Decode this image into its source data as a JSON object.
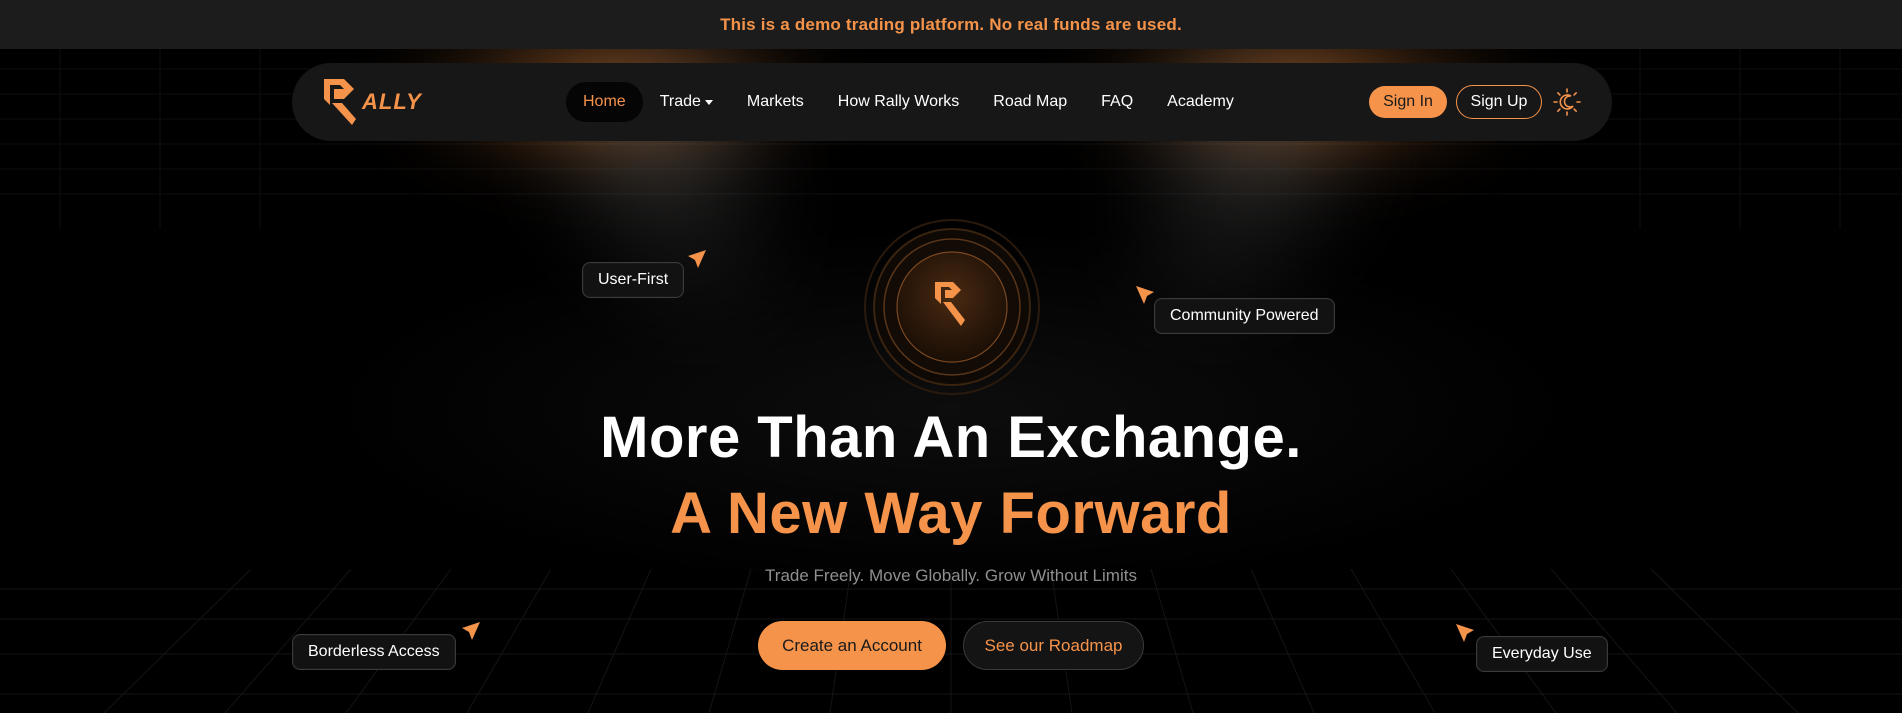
{
  "banner": {
    "text": "This is a demo trading platform. No real funds are used."
  },
  "brand": {
    "name": "ALLY",
    "accent": "#f5934a"
  },
  "nav": {
    "items": [
      {
        "label": "Home",
        "active": true
      },
      {
        "label": "Trade",
        "dropdown": true
      },
      {
        "label": "Markets"
      },
      {
        "label": "How Rally Works"
      },
      {
        "label": "Road Map"
      },
      {
        "label": "FAQ"
      },
      {
        "label": "Academy"
      }
    ],
    "sign_in": "Sign In",
    "sign_up": "Sign Up",
    "theme_icon": "sun-moon-icon"
  },
  "tags": {
    "user_first": "User-First",
    "community": "Community Powered",
    "borderless": "Borderless Access",
    "everyday": "Everyday Use"
  },
  "hero": {
    "title": "More Than An Exchange.",
    "subtitle": "A New Way Forward",
    "tagline": "Trade Freely. Move Globally. Grow Without Limits",
    "cta_primary": "Create an Account",
    "cta_secondary": "See our Roadmap"
  },
  "colors": {
    "accent": "#f5934a",
    "background": "#000000",
    "banner_bg": "#1c1c1c",
    "navbar_bg": "#171717"
  }
}
